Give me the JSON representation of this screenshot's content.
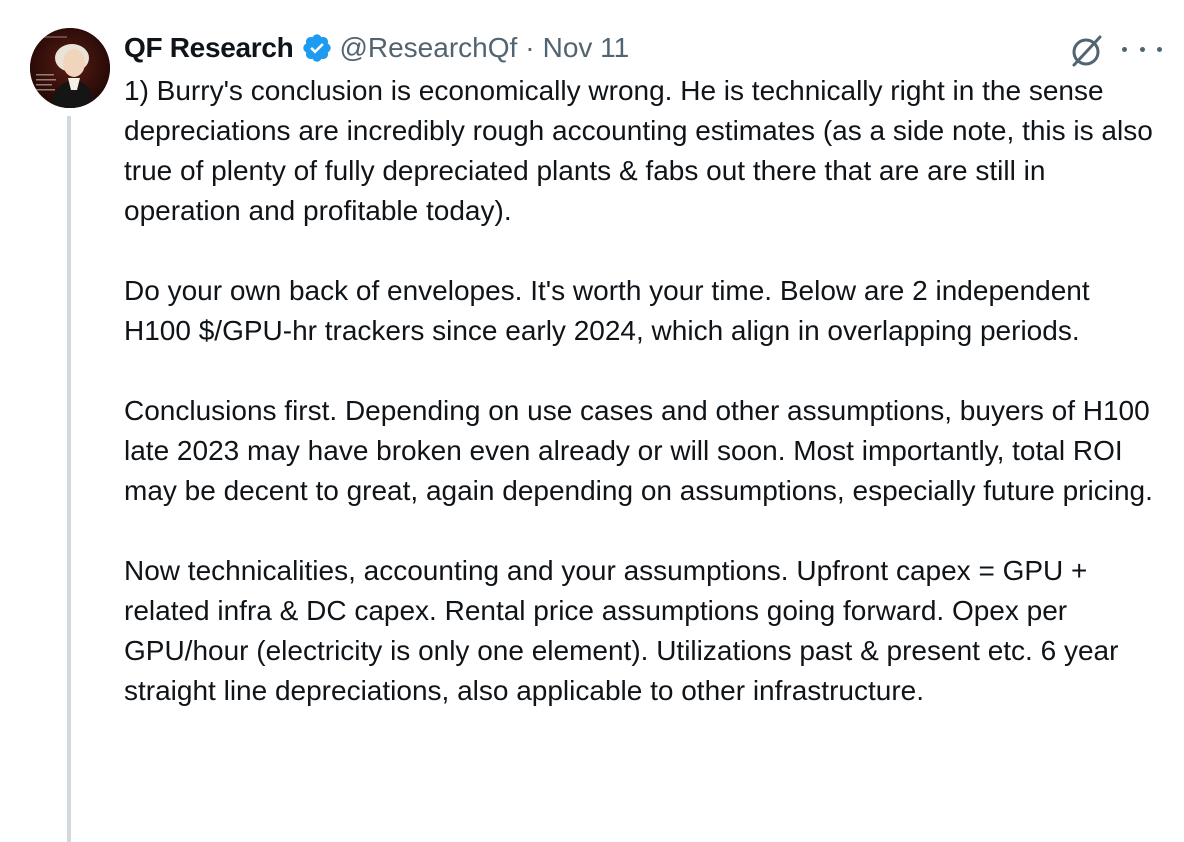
{
  "author": {
    "display_name": "QF Research",
    "handle": "@ResearchQf",
    "separator": "·",
    "date": "Nov 11",
    "verified": true,
    "verified_color": "#1d9bf0"
  },
  "icons": {
    "grok": "grok-icon",
    "more": "more-icon",
    "verified": "verified-badge-icon",
    "avatar": "avatar"
  },
  "tweet": {
    "paragraphs": [
      "1) Burry's conclusion is economically wrong. He is technically right in the sense depreciations are incredibly rough accounting estimates (as a side note, this is also true of plenty of fully depreciated plants & fabs out there that are are still in operation and profitable today).",
      "Do your own back of envelopes. It's worth your time. Below are 2 independent H100 $/GPU-hr trackers since early 2024, which align in overlapping periods.",
      "Conclusions first. Depending on use cases and other assumptions, buyers of H100 late 2023 may have broken even already or will soon. Most importantly, total ROI may be decent to great, again depending on assumptions, especially future pricing.",
      "Now technicalities, accounting and your assumptions. Upfront capex = GPU + related infra & DC capex. Rental price assumptions going forward. Opex per GPU/hour (electricity is only one element). Utilizations past & present etc. 6 year straight line depreciations, also applicable to other infrastructure."
    ]
  },
  "colors": {
    "text_primary": "#0f1419",
    "text_secondary": "#536471",
    "thread_line": "#cfd9de",
    "background": "#ffffff"
  }
}
